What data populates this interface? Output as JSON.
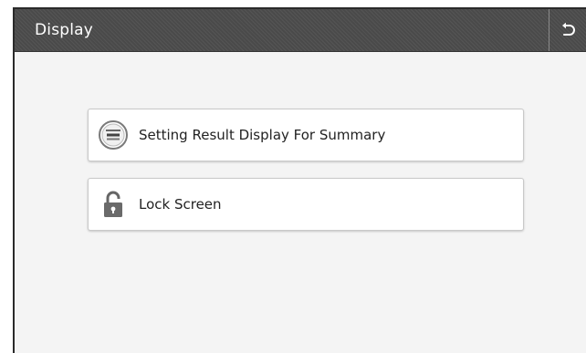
{
  "header": {
    "title": "Display",
    "back_icon": "back-arrow-icon"
  },
  "menu": {
    "items": [
      {
        "label": "Setting Result Display For Summary",
        "icon": "summary-display-icon"
      },
      {
        "label": "Lock Screen",
        "icon": "lock-icon"
      }
    ]
  },
  "colors": {
    "header_bg": "#4a4a4a",
    "panel_bg": "#f4f4f4",
    "card_bg": "#ffffff"
  }
}
